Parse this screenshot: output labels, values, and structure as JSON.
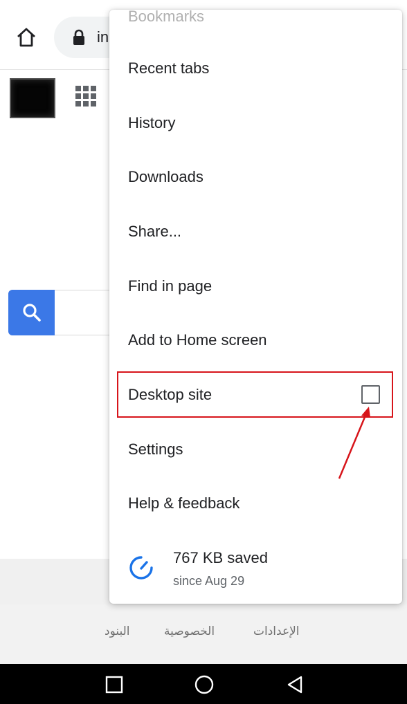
{
  "toolbar": {
    "url_fragment": "in",
    "home_icon": "home-icon",
    "lock_icon": "lock-icon"
  },
  "menu": {
    "partial_item": "Bookmarks",
    "items": [
      {
        "label": "Recent tabs"
      },
      {
        "label": "History"
      },
      {
        "label": "Downloads"
      },
      {
        "label": "Share..."
      },
      {
        "label": "Find in page"
      },
      {
        "label": "Add to Home screen"
      },
      {
        "label": "Desktop site",
        "checked": false
      },
      {
        "label": "Settings"
      },
      {
        "label": "Help & feedback"
      }
    ],
    "savings": {
      "title": "767 KB saved",
      "subtitle": "since Aug 29",
      "icon": "data-saver-icon"
    }
  },
  "footer": {
    "links": [
      "الإعدادات",
      "الخصوصية",
      "البنود"
    ]
  },
  "colors": {
    "accent_blue": "#3b78e7",
    "annotation_red": "#d7141a",
    "text_primary": "#202124",
    "text_secondary": "#5f6368"
  }
}
